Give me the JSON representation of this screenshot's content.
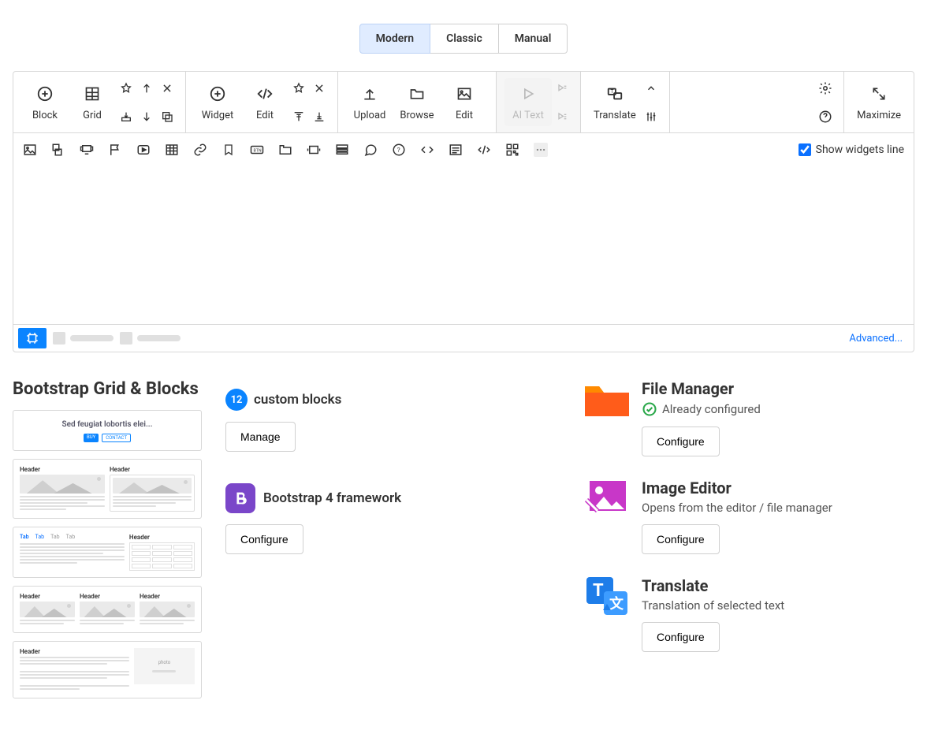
{
  "tabs": {
    "modern": "Modern",
    "classic": "Classic",
    "manual": "Manual"
  },
  "toolbar": {
    "block": "Block",
    "grid": "Grid",
    "widget": "Widget",
    "edit": "Edit",
    "upload": "Upload",
    "browse": "Browse",
    "edit2": "Edit",
    "aitext": "AI Text",
    "translate": "Translate",
    "maximize": "Maximize",
    "show_widgets": "Show widgets line"
  },
  "statusbar": {
    "advanced": "Advanced..."
  },
  "grid_section": {
    "title": "Bootstrap Grid & Blocks"
  },
  "mid": {
    "blocks_count": "12",
    "blocks_label": "custom blocks",
    "manage": "Manage",
    "bs_label": "Bootstrap 4 framework",
    "configure": "Configure"
  },
  "features": {
    "fm": {
      "title": "File Manager",
      "sub": "Already configured",
      "btn": "Configure"
    },
    "ie": {
      "title": "Image Editor",
      "sub": "Opens from the editor / file manager",
      "btn": "Configure"
    },
    "tr": {
      "title": "Translate",
      "sub": "Translation of selected text",
      "btn": "Configure"
    }
  }
}
